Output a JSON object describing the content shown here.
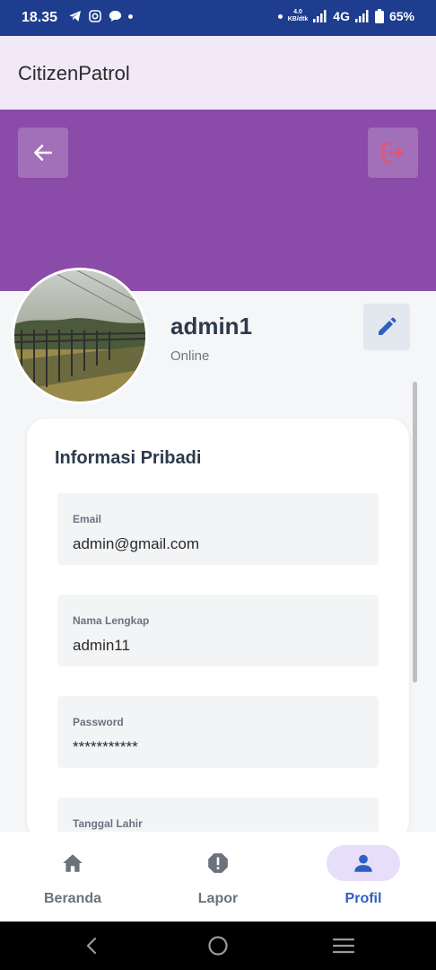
{
  "status_bar": {
    "time": "18.35",
    "net_speed_value": "4.0",
    "net_speed_unit": "KB/dtk",
    "network": "4G",
    "battery": "65%"
  },
  "app_bar": {
    "title": "CitizenPatrol"
  },
  "profile": {
    "username": "admin1",
    "status": "Online"
  },
  "info_card": {
    "title": "Informasi Pribadi",
    "fields": [
      {
        "label": "Email",
        "value": "admin@gmail.com"
      },
      {
        "label": "Nama Lengkap",
        "value": "admin11"
      },
      {
        "label": "Password",
        "value": "***********"
      },
      {
        "label": "Tanggal Lahir",
        "value": ""
      }
    ]
  },
  "bottom_nav": {
    "items": [
      {
        "label": "Beranda",
        "icon": "home-icon",
        "active": false
      },
      {
        "label": "Lapor",
        "icon": "alert-icon",
        "active": false
      },
      {
        "label": "Profil",
        "icon": "person-icon",
        "active": true
      }
    ]
  },
  "colors": {
    "header": "#8b4ba8",
    "status_bar": "#1e3d8f",
    "accent": "#2f5fbf",
    "logout": "#e2556e"
  }
}
